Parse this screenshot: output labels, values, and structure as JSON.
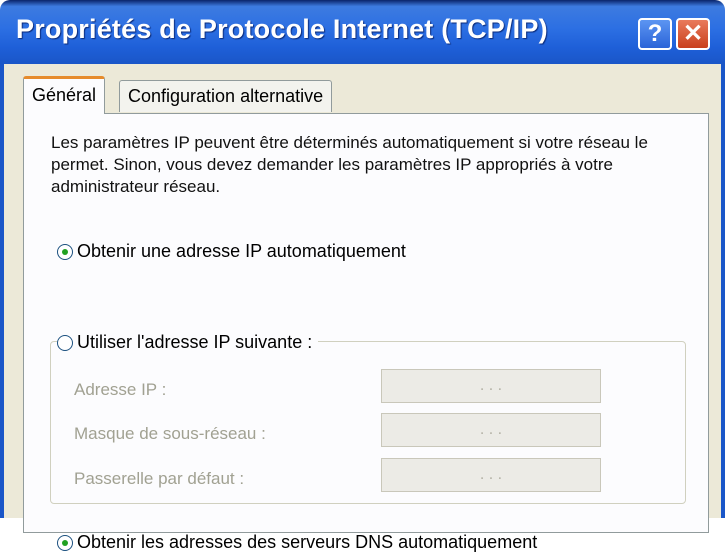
{
  "window": {
    "title": "Propriétés de Protocole Internet (TCP/IP)",
    "help_label": "?",
    "close_label": "✕"
  },
  "tabs": [
    {
      "label": "Général",
      "active": true
    },
    {
      "label": "Configuration alternative",
      "active": false
    }
  ],
  "general": {
    "description": "Les paramètres IP peuvent être déterminés automatiquement si votre réseau le permet. Sinon, vous devez demander les paramètres IP appropriés à votre administrateur réseau.",
    "radio_auto_ip": {
      "label": "Obtenir une adresse IP automatiquement",
      "checked": true
    },
    "radio_manual_ip": {
      "label": "Utiliser l'adresse IP suivante :",
      "checked": false
    },
    "fields": [
      {
        "label": "Adresse IP :",
        "value": ". . ."
      },
      {
        "label": "Masque de sous-réseau :",
        "value": ". . ."
      },
      {
        "label": "Passerelle par défaut :",
        "value": ". . ."
      }
    ],
    "radio_auto_dns": {
      "label": "Obtenir les adresses des serveurs DNS automatiquement",
      "checked": true
    }
  },
  "colors": {
    "titlebar": "#2c6fe3",
    "dialog_bg": "#ece9d8",
    "radio_dot": "#21a121",
    "active_tab_accent": "#e68b2c"
  }
}
